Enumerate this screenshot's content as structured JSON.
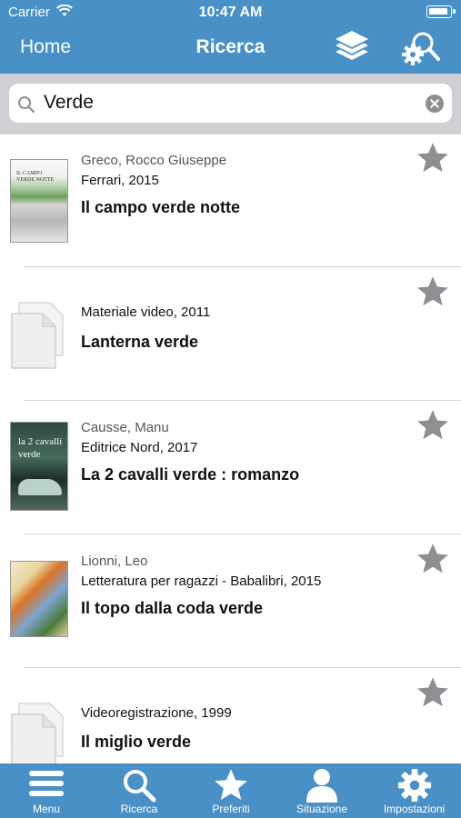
{
  "status_bar": {
    "carrier": "Carrier",
    "time": "10:47 AM"
  },
  "nav": {
    "back_label": "Home",
    "title": "Ricerca",
    "layers_icon": "layers-icon",
    "advanced_search_icon": "search-gear-icon"
  },
  "search": {
    "value": "Verde"
  },
  "results": [
    {
      "author": "Greco, Rocco Giuseppe",
      "publisher": "Ferrari, 2015",
      "title": "Il campo verde notte"
    },
    {
      "author": "",
      "publisher": "Materiale video, 2011",
      "title": "Lanterna verde"
    },
    {
      "author": "Causse, Manu",
      "publisher": "Editrice Nord, 2017",
      "title": "La 2 cavalli verde : romanzo"
    },
    {
      "author": "Lionni, Leo",
      "publisher": "Letteratura per ragazzi - Babalibri, 2015",
      "title": "Il topo dalla coda verde"
    },
    {
      "author": "",
      "publisher": "Videoregistrazione, 1999",
      "title": "Il miglio verde"
    }
  ],
  "tabs": [
    {
      "label": "Menu",
      "icon": "menu-icon"
    },
    {
      "label": "Ricerca",
      "icon": "search-icon"
    },
    {
      "label": "Preferiti",
      "icon": "star-icon"
    },
    {
      "label": "Situazione",
      "icon": "user-icon"
    },
    {
      "label": "Impostazioni",
      "icon": "gear-icon"
    }
  ],
  "colors": {
    "brand": "#4990c6",
    "star": "#8e8e93"
  }
}
